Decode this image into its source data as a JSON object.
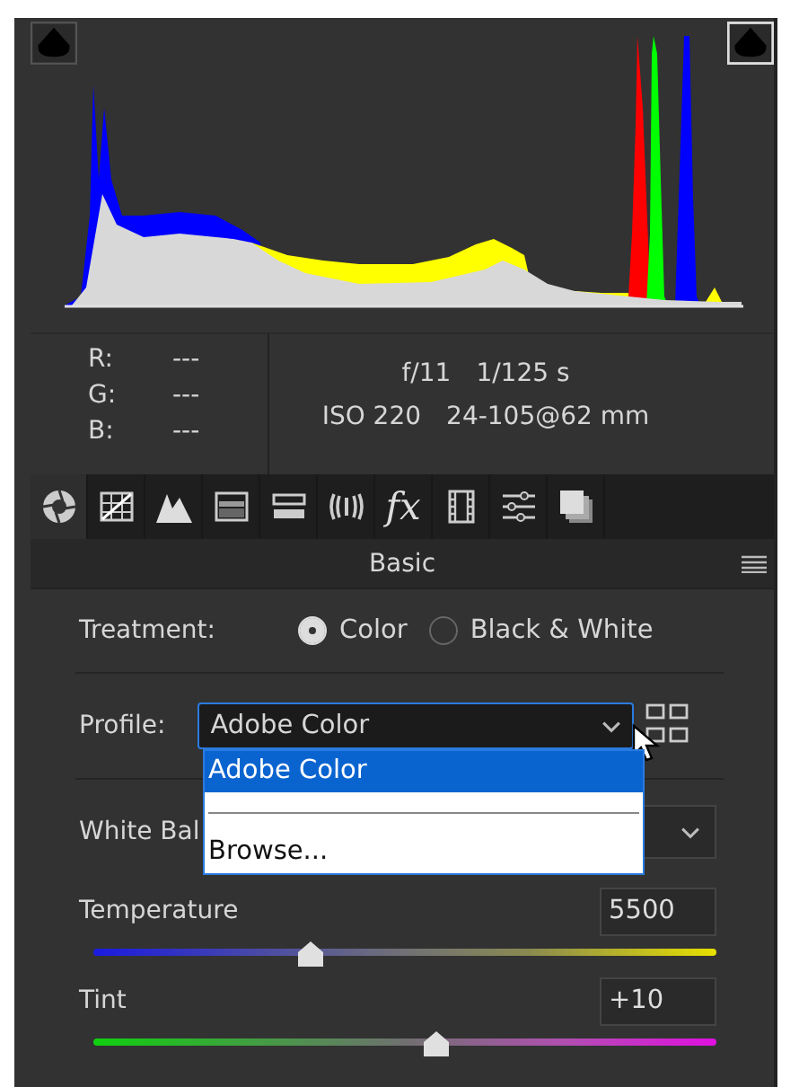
{
  "histogram": {
    "clipping": {
      "shadows": false,
      "highlights": true
    }
  },
  "readout": {
    "rgb": [
      {
        "label": "R:",
        "value": "---"
      },
      {
        "label": "G:",
        "value": "---"
      },
      {
        "label": "B:",
        "value": "---"
      }
    ],
    "exposure": [
      [
        "f/11",
        "1/125 s"
      ],
      [
        "ISO 220",
        "24-105@62 mm"
      ]
    ]
  },
  "tool_tabs": [
    {
      "kind": "basic",
      "selected": true
    },
    {
      "kind": "curve",
      "selected": false
    },
    {
      "kind": "detail",
      "selected": false
    },
    {
      "kind": "hsl",
      "selected": false
    },
    {
      "kind": "split",
      "selected": false
    },
    {
      "kind": "lens",
      "selected": false
    },
    {
      "kind": "effects",
      "label": "fx",
      "selected": false
    },
    {
      "kind": "calibration",
      "selected": false
    },
    {
      "kind": "presets",
      "selected": false
    },
    {
      "kind": "snapshots",
      "selected": false
    }
  ],
  "panel": {
    "title": "Basic"
  },
  "treatment": {
    "label": "Treatment:",
    "options": [
      {
        "label": "Color",
        "selected": true
      },
      {
        "label": "Black & White",
        "selected": false
      }
    ]
  },
  "profile": {
    "label": "Profile:",
    "value": "Adobe Color",
    "menu": [
      {
        "kind": "item",
        "label": "Adobe Color",
        "selected": true
      },
      {
        "kind": "separator"
      },
      {
        "kind": "item",
        "label": "Browse...",
        "selected": false
      }
    ]
  },
  "white_balance": {
    "label": "White Bal"
  },
  "sliders": [
    {
      "label": "Temperature",
      "value": "5500",
      "kind": "temperature",
      "level": 0.35
    },
    {
      "label": "Tint",
      "value": "+10",
      "kind": "tint",
      "level": 0.55
    }
  ]
}
